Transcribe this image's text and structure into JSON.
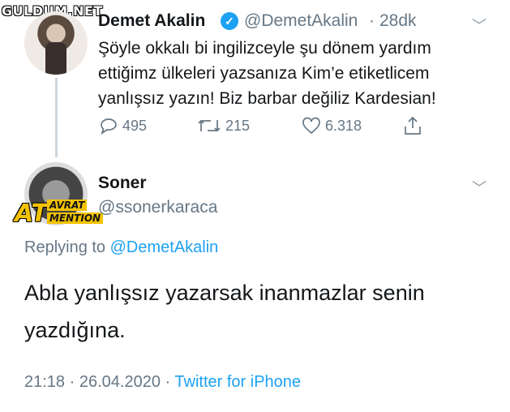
{
  "watermark": "GULDUM.NET",
  "original_tweet": {
    "display_name": "Demet Akalin",
    "handle": "@DemetAkalin",
    "separator": "·",
    "time_ago": "28dk",
    "text": "Şöyle okkalı bi ingilizceyle şu dönem yardım ettiğimz ülkeleri yazsanıza Kim’e etiketlicem yanlışsız yazın! Biz barbar değiliz Kardesian!",
    "replies": "495",
    "retweets": "215",
    "likes": "6.318"
  },
  "reply_tweet": {
    "display_name": "Soner",
    "handle": "@ssonerkaraca",
    "badge": {
      "at": "AT",
      "avrat": "AVRAT",
      "mention": "MENTION"
    },
    "replying_prefix": "Replying to",
    "replying_to": "@DemetAkalin",
    "text": "Abla yanlışsız yazarsak inanmazlar senin yazdığına.",
    "time": "21:18",
    "dot": "·",
    "date": "26.04.2020",
    "source": "Twitter for iPhone"
  },
  "colors": {
    "accent": "#1da1f2",
    "secondary_text": "#657786",
    "primary_text": "#14171a"
  }
}
